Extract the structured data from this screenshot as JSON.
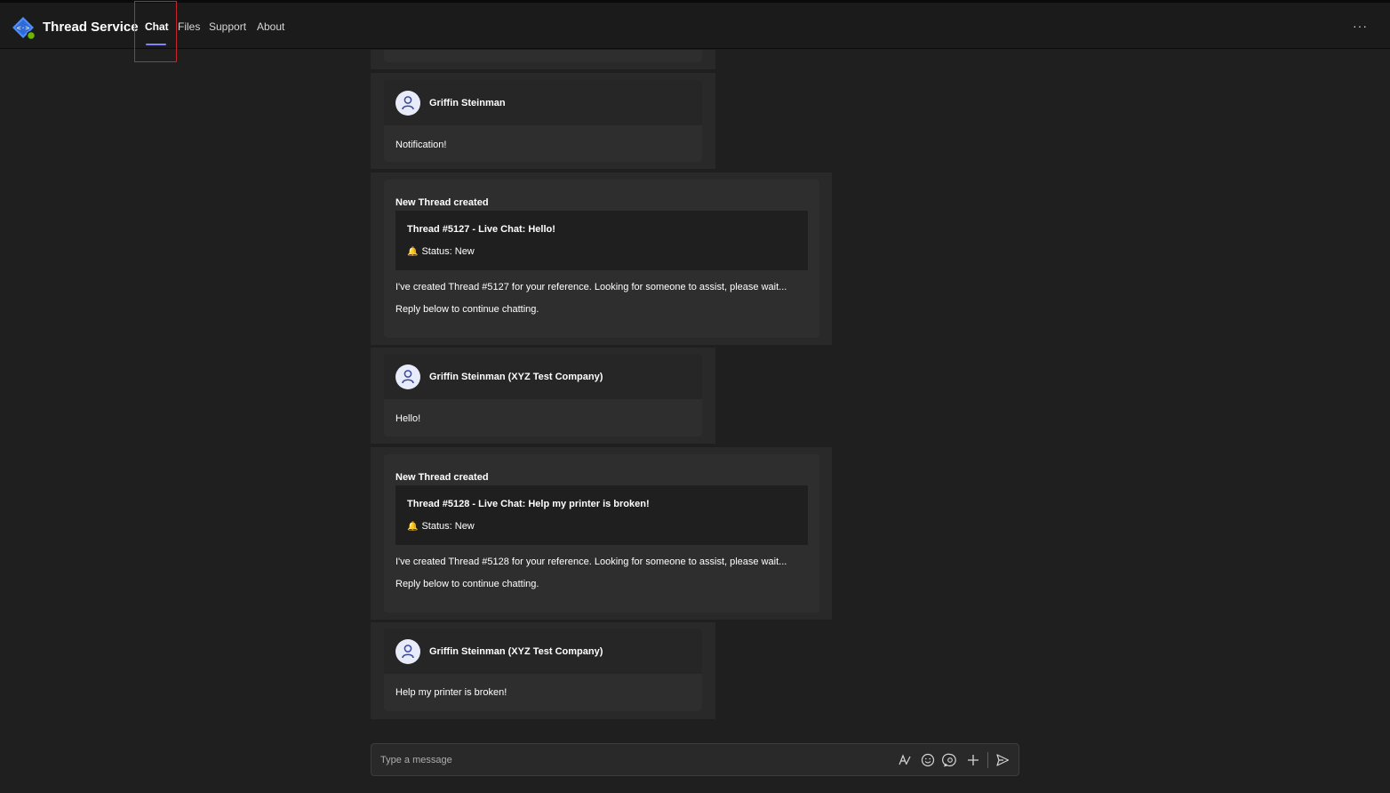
{
  "app": {
    "title": "Thread Service",
    "tabs": [
      "Chat",
      "Files",
      "Support",
      "About"
    ],
    "active_tab": "Chat",
    "more_label": "···"
  },
  "messages": {
    "m1": {
      "author": "Griffin Steinman",
      "text": "Notification!"
    },
    "t1": {
      "title": "New Thread created",
      "thread": "Thread #5127 - Live Chat: Hello!",
      "status": "Status: New",
      "line1": "I've created Thread #5127 for your reference. Looking for someone to assist, please wait...",
      "line2": "Reply below to continue chatting."
    },
    "m2": {
      "author": "Griffin Steinman (XYZ Test Company)",
      "text": "Hello!"
    },
    "t2": {
      "title": "New Thread created",
      "thread": "Thread #5128 - Live Chat: Help my printer is broken!",
      "status": "Status: New",
      "line1": "I've created Thread #5128 for your reference. Looking for someone to assist, please wait...",
      "line2": "Reply below to continue chatting."
    },
    "m3": {
      "author": "Griffin Steinman (XYZ Test Company)",
      "text": "Help my printer is broken!"
    }
  },
  "composer": {
    "placeholder": "Type a message",
    "icons": [
      "format-icon",
      "emoji-icon",
      "sticker-icon",
      "attach-icon",
      "send-icon"
    ]
  },
  "colors": {
    "accent": "#7f85f5",
    "highlight": "#c4262e",
    "status_bell": "#f3c044"
  }
}
